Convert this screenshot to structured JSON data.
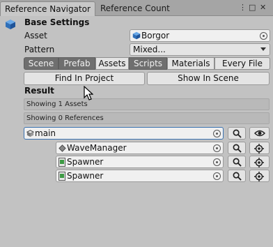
{
  "tabs": [
    {
      "label": "Reference Navigator"
    },
    {
      "label": "Reference Count"
    }
  ],
  "window_icons": {
    "menu": "⋮",
    "maximize": "□",
    "close": "✕"
  },
  "base_settings": {
    "title": "Base Settings",
    "asset_label": "Asset",
    "asset_value": "Borgor",
    "pattern_label": "Pattern",
    "pattern_value": "Mixed..."
  },
  "filters": [
    {
      "label": "Scene",
      "selected": true
    },
    {
      "label": "Prefab",
      "selected": true
    },
    {
      "label": "Assets",
      "selected": false
    },
    {
      "label": "Scripts",
      "selected": true
    },
    {
      "label": "Materials",
      "selected": false
    },
    {
      "label": "Every File",
      "selected": false
    }
  ],
  "actions": {
    "find_in_project": "Find In Project",
    "show_in_scene": "Show In Scene"
  },
  "result": {
    "title": "Result",
    "assets_info": "Showing 1 Assets",
    "references_info": "Showing 0 References",
    "root": {
      "name": "main",
      "icon": "prefab-icon"
    },
    "items": [
      {
        "name": "WaveManager",
        "icon": "gameobject-icon"
      },
      {
        "name": "Spawner",
        "icon": "script-icon"
      },
      {
        "name": "Spawner",
        "icon": "script-icon"
      }
    ]
  },
  "colors": {
    "accent": "#3a72b0",
    "selected_segment": "#6f6f6f",
    "background": "#c2c2c2"
  }
}
